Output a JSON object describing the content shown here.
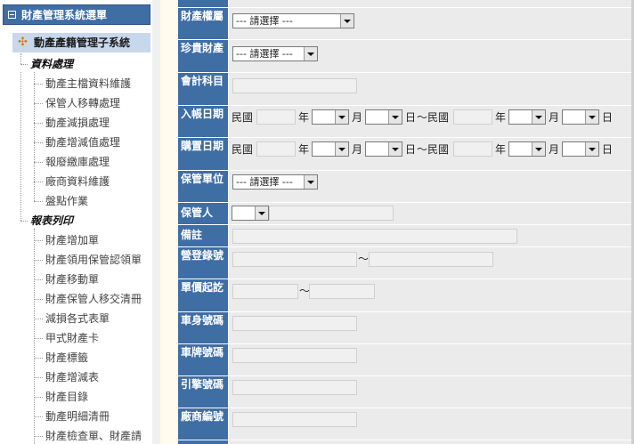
{
  "sidebar": {
    "title": "財產管理系統選單",
    "subtitle": "動產產籍管理子系統",
    "groups": [
      {
        "label": "資料處理",
        "items": [
          "動產主檔資料維護",
          "保管人移轉處理",
          "動產減損處理",
          "動產增減值處理",
          "報廢繳庫處理",
          "廠商資料維護",
          "盤點作業"
        ]
      },
      {
        "label": "報表列印",
        "items": [
          "財產增加單",
          "財產領用保管認領單",
          "財產移動單",
          "財產保管人移交清冊",
          "減損各式表單",
          "甲式財產卡",
          "財產標籤",
          "財產增減表",
          "財產目錄",
          "動產明細清冊",
          "財產檢查單、財產請"
        ]
      }
    ]
  },
  "form": {
    "select_placeholder": "--- 請選擇 ---",
    "fields": {
      "ownership": "財產權屬",
      "precious": "珍貴財產",
      "account": "會計科目",
      "entry_date": "入帳日期",
      "purchase_date": "購置日期",
      "custody_unit": "保管單位",
      "custodian": "保管人",
      "remark": "備註",
      "reg_no": "營登錄號",
      "unit_price": "單價起訖",
      "body_no": "車身號碼",
      "plate_no": "車牌號碼",
      "engine_no": "引擎號碼",
      "vendor_no": "廠商編號"
    },
    "date_words": {
      "roc": "民國",
      "year": "年",
      "month": "月",
      "day": "日",
      "range_roc": "～民國"
    },
    "tilde": "～"
  }
}
